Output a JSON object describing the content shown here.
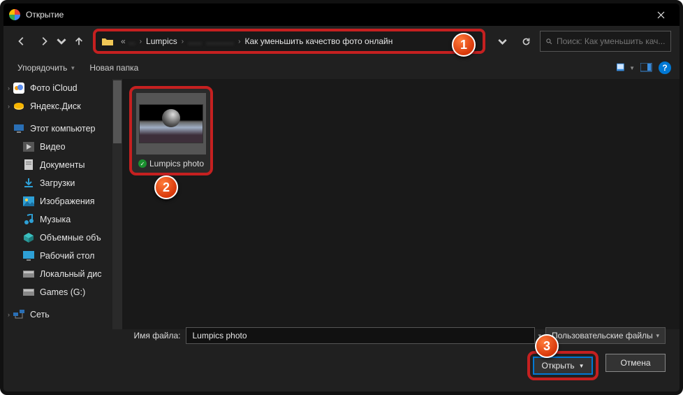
{
  "window": {
    "title": "Открытие"
  },
  "nav": {
    "breadcrumb": {
      "pre": "«",
      "part_blur1": "...",
      "part1": "Lumpics",
      "part_blur2": "......",
      "part_blur3": "............",
      "part2": "Как уменьшить качество фото онлайн"
    },
    "search_placeholder": "Поиск: Как уменьшить кач..."
  },
  "toolbar": {
    "organize": "Упорядочить",
    "new_folder": "Новая папка"
  },
  "sidebar": {
    "items": [
      {
        "label": "Фото iCloud"
      },
      {
        "label": "Яндекс.Диск"
      },
      {
        "label": "Этот компьютер"
      },
      {
        "label": "Видео"
      },
      {
        "label": "Документы"
      },
      {
        "label": "Загрузки"
      },
      {
        "label": "Изображения"
      },
      {
        "label": "Музыка"
      },
      {
        "label": "Объемные объ"
      },
      {
        "label": "Рабочий стол"
      },
      {
        "label": "Локальный дис"
      },
      {
        "label": "Games (G:)"
      },
      {
        "label": "Сеть"
      }
    ]
  },
  "file": {
    "name": "Lumpics photo"
  },
  "footer": {
    "filename_label": "Имя файла:",
    "filename_value": "Lumpics photo",
    "filter_label": "Пользовательские файлы",
    "open": "Открыть",
    "cancel": "Отмена"
  },
  "badges": {
    "b1": "1",
    "b2": "2",
    "b3": "3"
  }
}
